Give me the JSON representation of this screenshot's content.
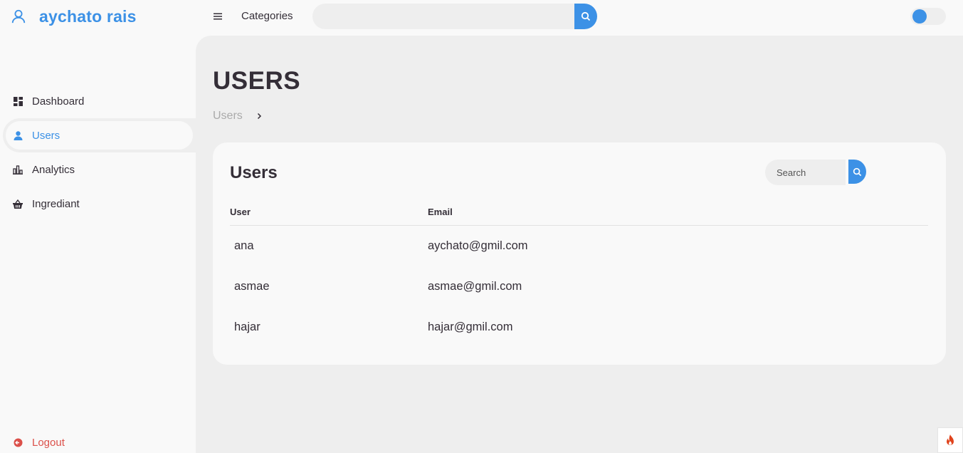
{
  "brand": {
    "name": "aychato rais",
    "icon": "user-outline-icon"
  },
  "sidebar": {
    "items": [
      {
        "label": "Dashboard",
        "icon": "grid-icon"
      },
      {
        "label": "Users",
        "icon": "user-icon",
        "active": true
      },
      {
        "label": "Analytics",
        "icon": "bar-chart-icon"
      },
      {
        "label": "Ingrediant",
        "icon": "basket-icon"
      }
    ],
    "logout": {
      "label": "Logout",
      "icon": "logout-icon"
    }
  },
  "topnav": {
    "categories_label": "Categories",
    "search_placeholder": "",
    "theme_toggle": {
      "on": false
    }
  },
  "main": {
    "title": "USERS",
    "breadcrumb": [
      "Users"
    ]
  },
  "card": {
    "title": "Users",
    "search_placeholder": "Search",
    "columns": [
      "User",
      "Email"
    ],
    "rows": [
      {
        "user": "ana",
        "email": "aychato@gmil.com"
      },
      {
        "user": "asmae",
        "email": "asmae@gmil.com"
      },
      {
        "user": "hajar",
        "email": "hajar@gmil.com"
      }
    ]
  },
  "colors": {
    "accent": "#3c91e6",
    "danger": "#db504a",
    "text": "#342e37",
    "grey": "#eeeeee",
    "light": "#f9f9f9"
  }
}
